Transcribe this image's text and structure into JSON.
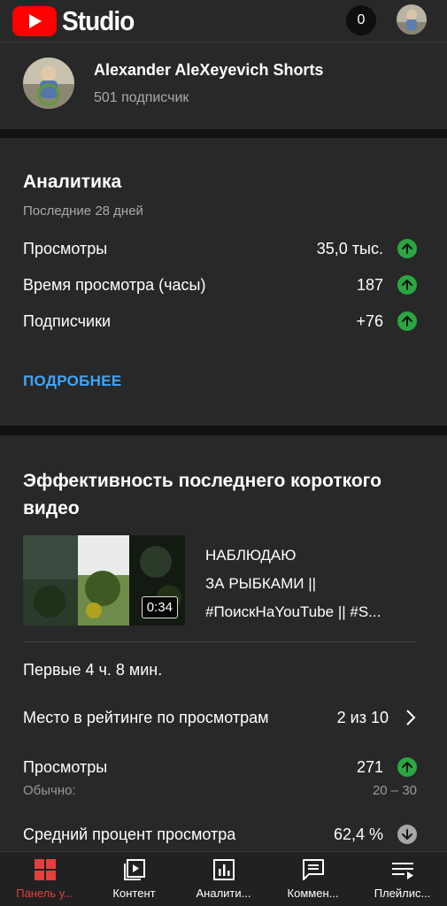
{
  "header": {
    "brand": "Studio",
    "notification_count": "0"
  },
  "channel": {
    "name": "Alexander AleXeyevich Shorts",
    "subscribers": "501 подписчик"
  },
  "analytics": {
    "title": "Аналитика",
    "period": "Последние 28 дней",
    "metrics": [
      {
        "label": "Просмотры",
        "value": "35,0 тыс.",
        "trend": "up"
      },
      {
        "label": "Время просмотра (часы)",
        "value": "187",
        "trend": "up"
      },
      {
        "label": "Подписчики",
        "value": "+76",
        "trend": "up"
      }
    ],
    "more_link": "ПОДРОБНЕЕ"
  },
  "short_performance": {
    "title": "Эффективность последнего короткого видео",
    "video": {
      "title_lines": [
        "НАБЛЮДАЮ",
        "ЗА РЫБКАМИ ||",
        "#ПоискНаYouTube || #S..."
      ],
      "duration": "0:34"
    },
    "first_hours": "Первые 4 ч. 8 мин.",
    "rank": {
      "label": "Место в рейтинге по просмотрам",
      "value": "2 из 10"
    },
    "views": {
      "label": "Просмотры",
      "value": "271",
      "trend": "up",
      "usual_label": "Обычно:",
      "usual_value": "20 – 30"
    },
    "avg_percent": {
      "label": "Средний процент просмотра",
      "value": "62,4 %",
      "trend": "down"
    }
  },
  "bottom_nav": [
    {
      "label": "Панель у...",
      "icon": "dashboard-icon",
      "active": true
    },
    {
      "label": "Контент",
      "icon": "content-icon",
      "active": false
    },
    {
      "label": "Аналити...",
      "icon": "analytics-icon",
      "active": false
    },
    {
      "label": "Коммен...",
      "icon": "comments-icon",
      "active": false
    },
    {
      "label": "Плейлис...",
      "icon": "playlist-icon",
      "active": false
    }
  ],
  "colors": {
    "background": "#282828",
    "accent_red": "#e3413d",
    "link_blue": "#3ea6ff",
    "trend_up": "#2ba640",
    "trend_neutral": "#a6a6a6"
  }
}
